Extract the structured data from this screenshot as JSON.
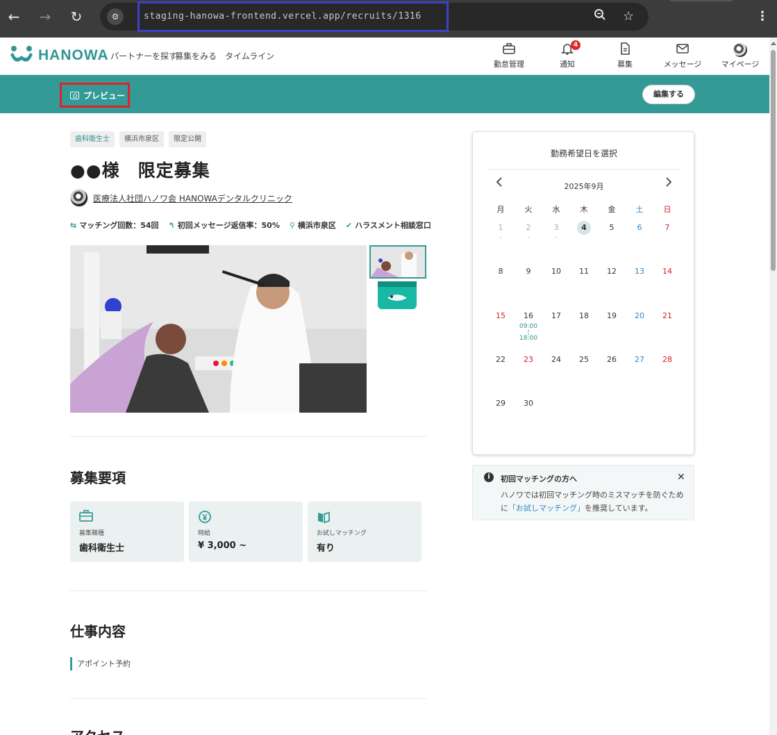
{
  "browser": {
    "url": "staging-hanowa-frontend.vercel.app/recruits/1316",
    "icons": [
      "back-icon",
      "forward-icon",
      "reload-icon",
      "site-info-icon",
      "zoom-out-icon",
      "star-icon",
      "menu-icon"
    ]
  },
  "app": {
    "logo_text": "HANOWA",
    "top_links": [
      "パートナーを探す",
      "募集をみる",
      "タイムライン"
    ],
    "nav": {
      "attendance": "勤怠管理",
      "notifications": "通知",
      "notification_count": "4",
      "recruit": "募集",
      "messages": "メッセージ",
      "mypage": "マイページ"
    },
    "accent_color": "#349a96"
  },
  "toolbar": {
    "preview_label": "プレビュー",
    "edit_label": "編集する"
  },
  "job": {
    "tags": [
      "歯科衛生士",
      "横浜市泉区",
      "限定公開"
    ],
    "title": "●●様　限定募集",
    "clinic_name": "医療法人社団ハノワ会 HANOWAデンタルクリニック",
    "stats": {
      "matching": "マッチング回数：54回",
      "reply_rate": "初回メッセージ返信率：50%",
      "location": "横浜市泉区",
      "harassment": "ハラスメント相談窓口"
    }
  },
  "requirements": {
    "title": "募集要項",
    "cards": [
      {
        "icon": "briefcase-icon",
        "label": "募集職種",
        "value": "歯科衛生士"
      },
      {
        "icon": "yen-icon",
        "label": "時給",
        "value": "¥ 3,000 ~"
      },
      {
        "icon": "book-icon",
        "label": "お試しマッチング",
        "value": "有り"
      }
    ]
  },
  "work": {
    "title": "仕事内容",
    "items": [
      "アポイント予約"
    ]
  },
  "access": {
    "title": "アクセス"
  },
  "calendar": {
    "heading": "勤務希望日を選択",
    "month": "2025年9月",
    "weekdays": [
      "月",
      "火",
      "水",
      "木",
      "金",
      "土",
      "日"
    ],
    "weeks": [
      [
        {
          "d": "1",
          "dim": true,
          "dash": "-"
        },
        {
          "d": "2",
          "dim": true,
          "dash": "-"
        },
        {
          "d": "3",
          "dim": true,
          "dash": "-"
        },
        {
          "d": "4",
          "today": true
        },
        {
          "d": "5"
        },
        {
          "d": "6",
          "kind": "sat"
        },
        {
          "d": "7",
          "kind": "sun"
        }
      ],
      [
        {
          "d": "8"
        },
        {
          "d": "9"
        },
        {
          "d": "10"
        },
        {
          "d": "11"
        },
        {
          "d": "12"
        },
        {
          "d": "13",
          "kind": "sat"
        },
        {
          "d": "14",
          "kind": "sun"
        }
      ],
      [
        {
          "d": "15",
          "kind": "sun"
        },
        {
          "d": "16",
          "time_start": "09:00",
          "time_end": "18:00"
        },
        {
          "d": "17"
        },
        {
          "d": "18"
        },
        {
          "d": "19"
        },
        {
          "d": "20",
          "kind": "sat"
        },
        {
          "d": "21",
          "kind": "sun"
        }
      ],
      [
        {
          "d": "22"
        },
        {
          "d": "23",
          "kind": "sun"
        },
        {
          "d": "24"
        },
        {
          "d": "25"
        },
        {
          "d": "26"
        },
        {
          "d": "27",
          "kind": "sat"
        },
        {
          "d": "28",
          "kind": "sun"
        }
      ],
      [
        {
          "d": "29"
        },
        {
          "d": "30"
        }
      ]
    ]
  },
  "notice": {
    "title": "初回マッチングの方へ",
    "body_prefix": "ハノワでは初回マッチング時のミスマッチを防ぐために",
    "body_link": "「お試しマッチング」",
    "body_suffix": "を推奨しています。"
  }
}
